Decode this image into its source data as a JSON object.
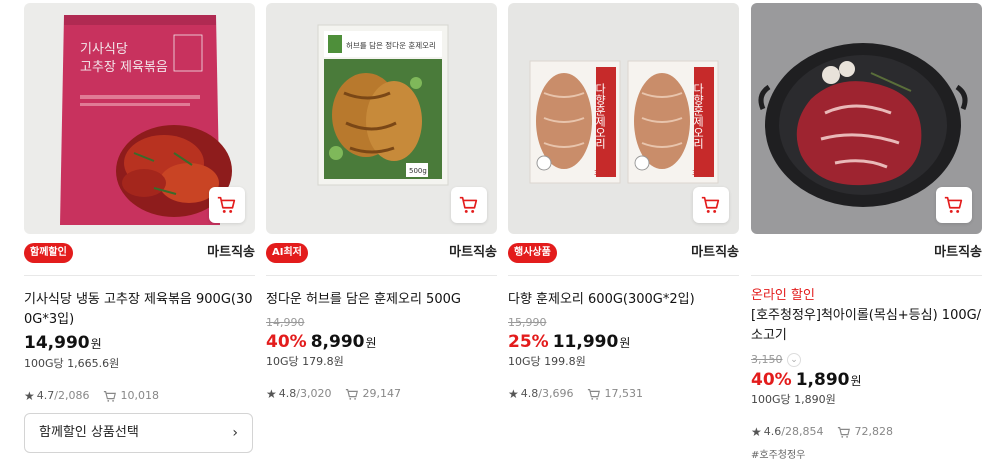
{
  "products": [
    {
      "badge": "함께할인",
      "shipping": "마트직송",
      "promo": "",
      "name": "기사식당 냉동 고추장 제육볶음 900G(300G*3입)",
      "original_price": "",
      "discount_rate": "",
      "price": "14,990",
      "won": "원",
      "unit_price": "100G당 1,665.6원",
      "rating": "4.7",
      "review_count": "/2,086",
      "cart_count": "10,018",
      "action_label": "함께할인 상품선택",
      "action_chevron": "›",
      "tag": "",
      "pack_title": "기사식당",
      "pack_subtitle": "고추장 제육볶음"
    },
    {
      "badge": "AI최저",
      "shipping": "마트직송",
      "promo": "",
      "name": "정다운 허브를 담은 훈제오리 500G",
      "original_price": "14,990",
      "discount_rate": "40%",
      "price": "8,990",
      "won": "원",
      "unit_price": "10G당 179.8원",
      "rating": "4.8",
      "review_count": "/3,020",
      "cart_count": "29,147",
      "action_label": "",
      "tag": "",
      "pack_title": "허브를 담은 정다운 훈제오리",
      "pack_weight": "500g"
    },
    {
      "badge": "행사상품",
      "shipping": "마트직송",
      "promo": "",
      "name": "다향 훈제오리 600G(300G*2입)",
      "original_price": "15,990",
      "discount_rate": "25%",
      "price": "11,990",
      "won": "원",
      "unit_price": "10G당 199.8원",
      "rating": "4.8",
      "review_count": "/3,696",
      "cart_count": "17,531",
      "action_label": "",
      "tag": "",
      "pack_title": "다향훈제오리",
      "pack_weight": "300g"
    },
    {
      "badge": "",
      "shipping": "마트직송",
      "promo": "온라인 할인",
      "name": "[호주청정우]척아이롤(목심+등심) 100G/소고기",
      "original_price": "3,150",
      "discount_rate": "40%",
      "price": "1,890",
      "won": "원",
      "unit_price": "100G당 1,890원",
      "rating": "4.6",
      "review_count": "/28,854",
      "cart_count": "72,828",
      "action_label": "",
      "tag": "#호주청정우"
    }
  ],
  "icons": {
    "cart": "cart-icon",
    "star": "star-icon",
    "chevron": "chevron-down-icon"
  },
  "colors": {
    "accent_red": "#e31c1c",
    "text_dark": "#111111",
    "text_muted": "#888888"
  }
}
